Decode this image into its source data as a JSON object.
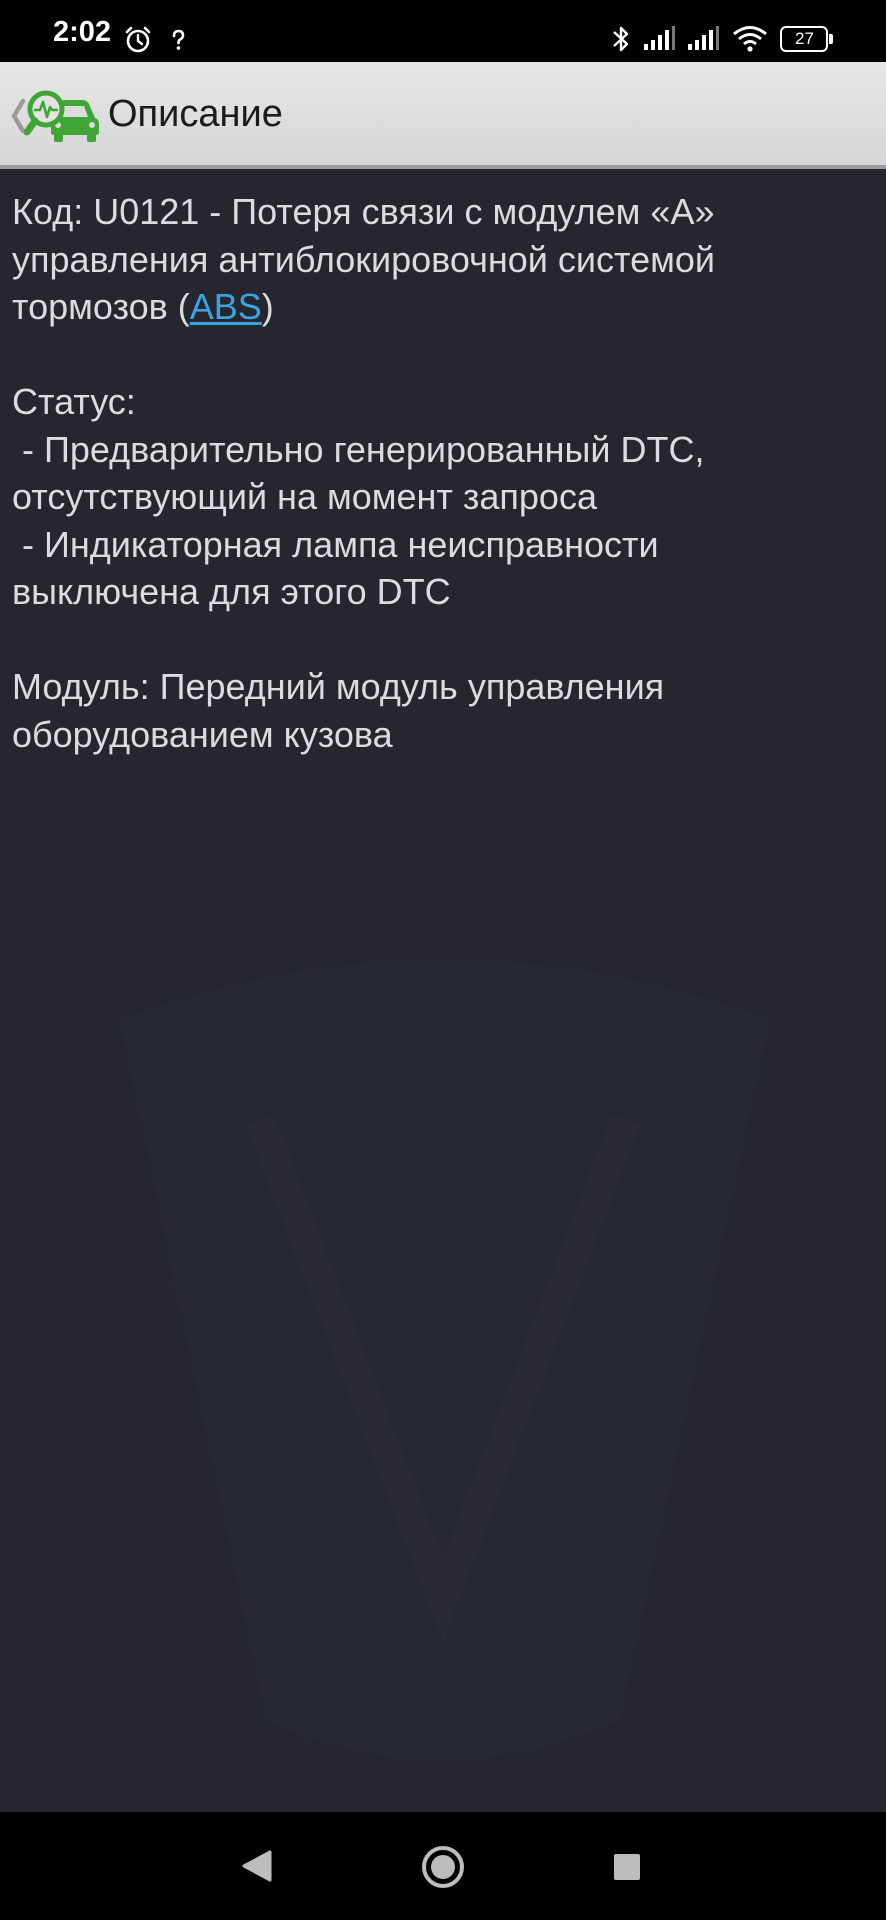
{
  "status_bar": {
    "time": "2:02",
    "battery_level": "27",
    "icons": [
      "alarm-icon",
      "unknown-network-icon",
      "bluetooth-icon",
      "signal-icon",
      "signal-icon",
      "wifi-icon",
      "battery-icon"
    ]
  },
  "app_bar": {
    "title": "Описание",
    "logo_icon": "car-diagnostics-logo-icon",
    "back_icon": "chevron-left-icon"
  },
  "content": {
    "code_line1": "Код: U0121 - Потеря связи с модулем «A»",
    "code_line2": "управления антиблокировочной системой",
    "code_line3_prefix": "тормозов (",
    "code_link": "ABS",
    "code_line3_suffix": ")",
    "status_label": "Статус:",
    "status_item1_line1": " - Предварительно генерированный DTC,",
    "status_item1_line2": "отсутствующий на момент запроса",
    "status_item2_line1": " - Индикаторная лампа неисправности",
    "status_item2_line2": "выключена для этого DTC",
    "module_line1": "Модуль: Передний модуль управления",
    "module_line2": "оборудованием кузова"
  },
  "nav_bar": {
    "icons": [
      "back-triangle-icon",
      "home-circle-icon",
      "recents-square-icon"
    ]
  },
  "colors": {
    "background": "#25262e",
    "text": "#dcdcde",
    "link": "#3ba3e0",
    "logo_green": "#3fa535"
  }
}
